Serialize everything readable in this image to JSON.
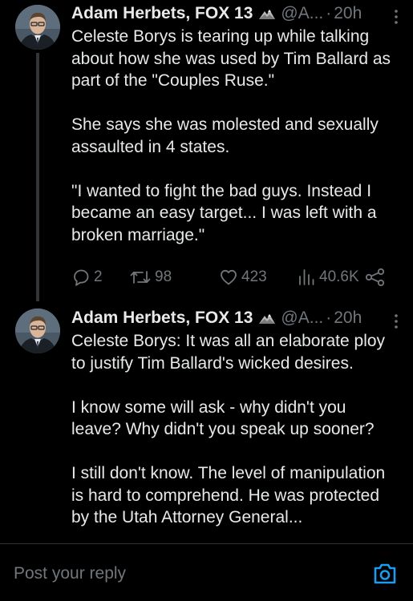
{
  "tweets": [
    {
      "author": "Adam Herbets, FOX 13",
      "handle": "@A...",
      "separator": "·",
      "time": "20h",
      "paragraphs": [
        "Celeste Borys is tearing up while talking about how she was used by Tim Ballard as part of the \"Couples Ruse.\"",
        "She says she was molested and sexually assaulted in 4 states.",
        "\"I wanted to fight the bad guys. Instead I became an easy target... I was left with a broken marriage.\""
      ],
      "stats": {
        "replies": "2",
        "retweets": "98",
        "likes": "423",
        "views": "40.6K"
      }
    },
    {
      "author": "Adam Herbets, FOX 13",
      "handle": "@A...",
      "separator": "·",
      "time": "20h",
      "paragraphs": [
        "Celeste Borys: It was all an elaborate ploy to justify Tim Ballard's wicked desires.",
        "I know some will ask - why didn't you leave? Why didn't you speak up sooner?",
        "I still don't know. The level of manipulation is hard to comprehend. He was protected by the Utah Attorney General..."
      ]
    }
  ],
  "reply": {
    "placeholder": "Post your reply"
  },
  "icons": {
    "badge": "mountain-badge-icon",
    "more": "more-icon",
    "reply": "reply-icon",
    "retweet": "retweet-icon",
    "like": "like-icon",
    "views": "views-icon",
    "share": "share-icon",
    "camera": "camera-icon"
  },
  "colors": {
    "background": "#000000",
    "text": "#e7e9ea",
    "muted": "#71767b",
    "accent": "#1d9bf0"
  }
}
